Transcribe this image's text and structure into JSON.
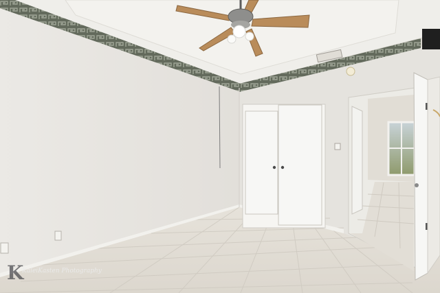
{
  "photo": {
    "subject": "empty bedroom interior",
    "colors": {
      "left_wall": "#e9e7e2",
      "right_wall": "#e4e2dd",
      "ceiling": "#efeeea",
      "border_trim": "#5d6258",
      "floor_tile": "#e3dfd7",
      "door": "#f6f6f4",
      "fan_blade": "#b98c5a"
    }
  },
  "watermark": {
    "logo_letter": "K",
    "text": "KaleiKasten Photography"
  }
}
